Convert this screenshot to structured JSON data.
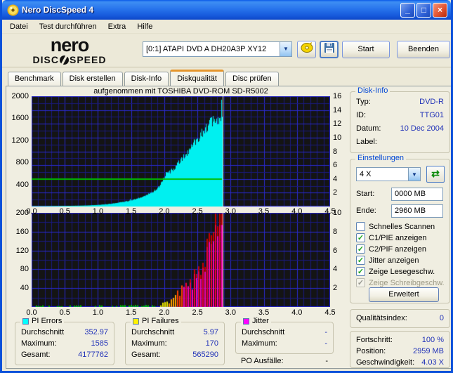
{
  "window": {
    "title": "Nero DiscSpeed 4",
    "minimize": "_",
    "maximize": "□",
    "close": "×"
  },
  "menu": {
    "items": [
      "Datei",
      "Test durchführen",
      "Extra",
      "Hilfe"
    ]
  },
  "toolbar": {
    "logo_line1": "nero",
    "logo_word1": "DISC",
    "logo_word2": "SPEED",
    "drive_value": "[0:1]   ATAPI DVD A  DH20A3P XY12",
    "eject_icon": "disc-eject-icon",
    "save_icon": "save-floppy-icon",
    "start_label": "Start",
    "quit_label": "Beenden"
  },
  "tabs": {
    "items": [
      "Benchmark",
      "Disk erstellen",
      "Disk-Info",
      "Diskqualität",
      "Disc prüfen"
    ],
    "active_index": 3
  },
  "chart_note": "aufgenommen mit TOSHIBA DVD-ROM SD-R5002",
  "chart_data": [
    {
      "type": "area",
      "series_name": "PI Errors",
      "fill_color": "#00F0F0",
      "x_min": 0,
      "x_max": 4.5,
      "x_ticks": [
        {
          "v": 0,
          "label": "0.0"
        },
        {
          "v": 0.5,
          "label": "0.5"
        },
        {
          "v": 1,
          "label": "1.0"
        },
        {
          "v": 1.5,
          "label": "1.5"
        },
        {
          "v": 2,
          "label": "2.0"
        },
        {
          "v": 2.5,
          "label": "2.5"
        },
        {
          "v": 3,
          "label": "3.0"
        },
        {
          "v": 3.5,
          "label": "3.5"
        },
        {
          "v": 4,
          "label": "4.0"
        },
        {
          "v": 4.5,
          "label": "4.5"
        }
      ],
      "y_left_max": 2000,
      "y_left_ticks": [
        {
          "v": 2000,
          "label": "2000"
        },
        {
          "v": 1600,
          "label": "1600"
        },
        {
          "v": 1200,
          "label": "1200"
        },
        {
          "v": 800,
          "label": "800"
        },
        {
          "v": 400,
          "label": "400"
        }
      ],
      "y_right_max": 16,
      "y_right_ticks": [
        {
          "v": 16,
          "label": "16"
        },
        {
          "v": 14,
          "label": "14"
        },
        {
          "v": 12,
          "label": "12"
        },
        {
          "v": 10,
          "label": "10"
        },
        {
          "v": 8,
          "label": "8"
        },
        {
          "v": 6,
          "label": "6"
        },
        {
          "v": 4,
          "label": "4"
        },
        {
          "v": 2,
          "label": "2"
        }
      ],
      "h_rows": 16,
      "h_major_every": 2,
      "data_end_x": 2.87,
      "cursor_x": 2.87,
      "speed_line": {
        "right_value": 4,
        "color": "#00BE00"
      },
      "points": [
        [
          0,
          6
        ],
        [
          0.2,
          7
        ],
        [
          0.4,
          10
        ],
        [
          0.6,
          13
        ],
        [
          0.8,
          18
        ],
        [
          1.0,
          28
        ],
        [
          1.1,
          38
        ],
        [
          1.2,
          52
        ],
        [
          1.3,
          68
        ],
        [
          1.4,
          88
        ],
        [
          1.5,
          112
        ],
        [
          1.6,
          145
        ],
        [
          1.7,
          190
        ],
        [
          1.8,
          250
        ],
        [
          1.9,
          335
        ],
        [
          1.95,
          430
        ],
        [
          2.0,
          560
        ],
        [
          2.05,
          610
        ],
        [
          2.1,
          645
        ],
        [
          2.15,
          695
        ],
        [
          2.2,
          765
        ],
        [
          2.25,
          840
        ],
        [
          2.3,
          925
        ],
        [
          2.35,
          975
        ],
        [
          2.4,
          1065
        ],
        [
          2.45,
          1165
        ],
        [
          2.5,
          1245
        ],
        [
          2.55,
          1315
        ],
        [
          2.6,
          1395
        ],
        [
          2.65,
          1465
        ],
        [
          2.7,
          1515
        ],
        [
          2.75,
          1548
        ],
        [
          2.8,
          1568
        ],
        [
          2.84,
          1582
        ],
        [
          2.87,
          1545
        ]
      ]
    },
    {
      "type": "bar",
      "series_name": "PI Failures",
      "x_min": 0,
      "x_max": 4.5,
      "x_ticks": [
        {
          "v": 0,
          "label": "0.0"
        },
        {
          "v": 0.5,
          "label": "0.5"
        },
        {
          "v": 1,
          "label": "1.0"
        },
        {
          "v": 1.5,
          "label": "1.5"
        },
        {
          "v": 2,
          "label": "2.0"
        },
        {
          "v": 2.5,
          "label": "2.5"
        },
        {
          "v": 3,
          "label": "3.0"
        },
        {
          "v": 3.5,
          "label": "3.5"
        },
        {
          "v": 4,
          "label": "4.0"
        },
        {
          "v": 4.5,
          "label": "4.5"
        }
      ],
      "y_left_max": 200,
      "y_left_ticks": [
        {
          "v": 200,
          "label": "200"
        },
        {
          "v": 160,
          "label": "160"
        },
        {
          "v": 120,
          "label": "120"
        },
        {
          "v": 80,
          "label": "80"
        },
        {
          "v": 40,
          "label": "40"
        }
      ],
      "y_right_max": 10,
      "y_right_ticks": [
        {
          "v": 10,
          "label": "10"
        },
        {
          "v": 8,
          "label": "8"
        },
        {
          "v": 6,
          "label": "6"
        },
        {
          "v": 4,
          "label": "4"
        },
        {
          "v": 2,
          "label": "2"
        }
      ],
      "h_rows": 10,
      "h_major_every": 2,
      "data_end_x": 2.87,
      "cursor_x": 2.87,
      "color_zones": [
        {
          "until": 1.92,
          "color": "#00D800"
        },
        {
          "until": 2.06,
          "color": "#F0EE00"
        },
        {
          "until": 2.17,
          "color": "#FF9E00"
        },
        {
          "until": 2.28,
          "color": "#FF4000"
        }
      ],
      "bar_alt_colors": [
        "#F2003C",
        "#FF00B0"
      ],
      "points": [
        [
          0,
          2
        ],
        [
          1.9,
          4
        ],
        [
          2.0,
          8
        ],
        [
          2.1,
          15
        ],
        [
          2.2,
          26
        ],
        [
          2.28,
          36
        ],
        [
          2.3,
          42
        ],
        [
          2.35,
          40
        ],
        [
          2.4,
          50
        ],
        [
          2.45,
          58
        ],
        [
          2.5,
          78
        ],
        [
          2.55,
          96
        ],
        [
          2.6,
          110
        ],
        [
          2.65,
          118
        ],
        [
          2.7,
          128
        ],
        [
          2.75,
          148
        ],
        [
          2.8,
          158
        ],
        [
          2.83,
          170
        ],
        [
          2.85,
          160
        ],
        [
          2.87,
          150
        ]
      ]
    }
  ],
  "disk_info": {
    "title": "Disk-Info",
    "rows": [
      {
        "label": "Typ:",
        "value": "DVD-R"
      },
      {
        "label": "ID:",
        "value": "TTG01"
      },
      {
        "label": "Datum:",
        "value": "10 Dec 2004"
      },
      {
        "label": "Label:",
        "value": ""
      }
    ]
  },
  "settings": {
    "title": "Einstellungen",
    "speed_value": "4 X",
    "refresh_icon": "refresh-icon",
    "start_label": "Start:",
    "start_value": "0000 MB",
    "end_label": "Ende:",
    "end_value": "2960 MB",
    "checkboxes": [
      {
        "label": "Schnelles Scannen",
        "checked": false,
        "disabled": false
      },
      {
        "label": "C1/PIE anzeigen",
        "checked": true,
        "disabled": false
      },
      {
        "label": "C2/PIF anzeigen",
        "checked": true,
        "disabled": false
      },
      {
        "label": "Jitter anzeigen",
        "checked": true,
        "disabled": false
      },
      {
        "label": "Zeige Lesegeschw.",
        "checked": true,
        "disabled": false
      },
      {
        "label": "Zeige Schreibgeschw.",
        "checked": true,
        "disabled": true
      }
    ],
    "advanced_label": "Erweitert"
  },
  "quality": {
    "label": "Qualitätsindex:",
    "value": "0"
  },
  "progress": {
    "rows": [
      {
        "label": "Fortschritt:",
        "value": "100 %"
      },
      {
        "label": "Position:",
        "value": "2959 MB"
      },
      {
        "label": "Geschwindigkeit:",
        "value": "4.03 X"
      }
    ]
  },
  "stats": [
    {
      "title": "PI Errors",
      "color": "#00FFFF",
      "rows": [
        {
          "label": "Durchschnitt",
          "value": "352.97"
        },
        {
          "label": "Maximum:",
          "value": "1585"
        },
        {
          "label": "Gesamt:",
          "value": "4177762"
        }
      ]
    },
    {
      "title": "PI Failures",
      "color": "#FFF200",
      "rows": [
        {
          "label": "Durchschnitt",
          "value": "5.97"
        },
        {
          "label": "Maximum:",
          "value": "170"
        },
        {
          "label": "Gesamt:",
          "value": "565290"
        }
      ]
    },
    {
      "title": "Jitter",
      "color": "#FF00FF",
      "rows": [
        {
          "label": "Durchschnitt",
          "value": "-"
        },
        {
          "label": "Maximum:",
          "value": "-"
        }
      ],
      "extra": {
        "label": "PO Ausfälle:",
        "value": "-"
      }
    }
  ]
}
